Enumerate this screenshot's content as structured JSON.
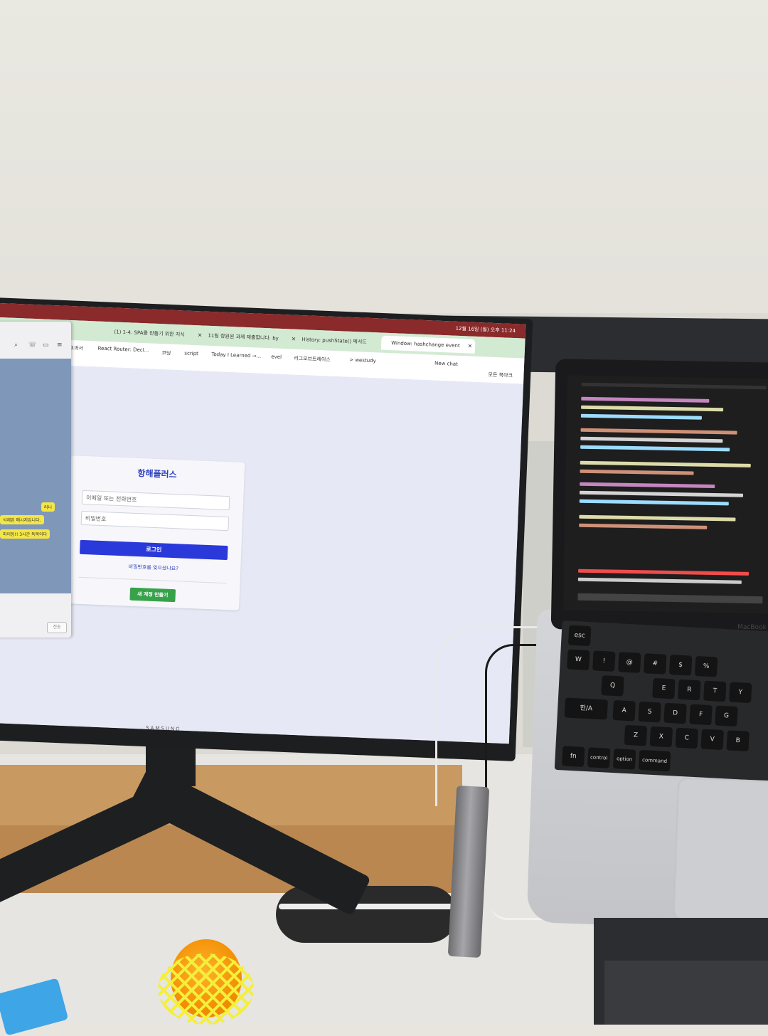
{
  "browser": {
    "tabs": [
      {
        "label": "(1) 1-4. SPA를 만들기 위한 지식",
        "active": false
      },
      {
        "label": "11팀 항원원 과제 제출합니다. by",
        "active": false
      },
      {
        "label": "History: pushState() 메서드",
        "active": false
      },
      {
        "label": "Window: hashchange event",
        "active": true
      }
    ],
    "clock": "12월 16일 (월) 오후 11:24",
    "bookmarks": [
      "교과서",
      "React Router: Decl...",
      "코딩",
      "script",
      "Today I Learned →...",
      "evel",
      "리그오브트레이스",
      "> westudy",
      "New chat",
      "모든 북마크"
    ]
  },
  "login": {
    "title": "항해플러스",
    "email_placeholder": "이메일 또는 전화번호",
    "password_placeholder": "비밀번호",
    "login_button": "로그인",
    "forgot_link": "비밀번호를 잊으셨나요?",
    "new_account_button": "새 계정 만들기"
  },
  "chat": {
    "bubbles": [
      "러니",
      "삭제된 메시지입니다.",
      "파이팅!! 3시간 독목이다"
    ],
    "send_button": "전송"
  },
  "laptop": {
    "label": "MacBook A",
    "keys": [
      "esc",
      "W",
      "!",
      "@",
      "#",
      "$",
      "%",
      "Q",
      "E",
      "R",
      "T",
      "Y",
      "A",
      "S",
      "D",
      "F",
      "G",
      "Z",
      "X",
      "C",
      "V",
      "B",
      "fn",
      "control",
      "option",
      "command",
      "한/A"
    ]
  },
  "monitor": {
    "brand": "SAMSUNG"
  },
  "colors": {
    "menubar": "#8a2a2a",
    "tabbar": "#d3ead2",
    "login_title": "#2a3fbf",
    "login_button": "#2a39d9",
    "new_account_button": "#37a24a",
    "chat_bg": "#7f97b8",
    "chat_bubble": "#f5e646"
  }
}
